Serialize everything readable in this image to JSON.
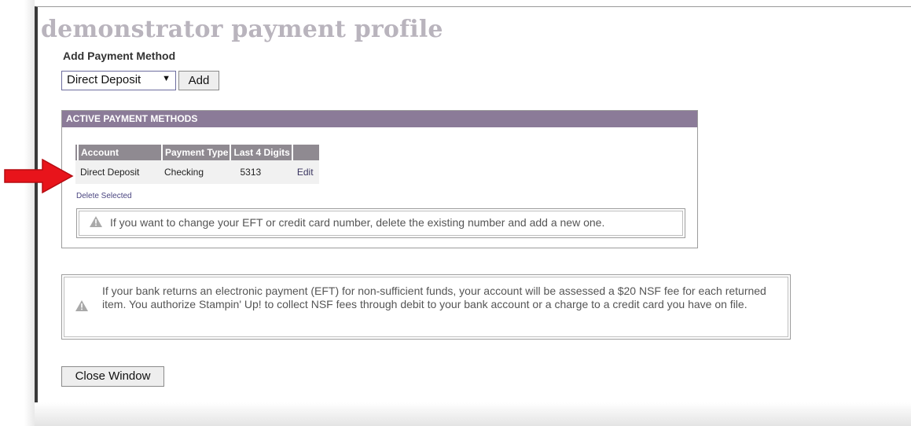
{
  "page": {
    "title": "demonstrator payment profile"
  },
  "add_method": {
    "label": "Add Payment Method",
    "selected_option": "Direct Deposit",
    "add_button": "Add"
  },
  "active_methods": {
    "header": "ACTIVE PAYMENT METHODS",
    "columns": [
      "Account",
      "Payment Type",
      "Last 4 Digits"
    ],
    "rows": [
      {
        "account": "Direct Deposit",
        "payment_type": "Checking",
        "last4": "5313",
        "action": "Edit"
      }
    ],
    "delete_link": "Delete Selected",
    "notice": "If you want to change your EFT or credit card number, delete the existing number and add a new one."
  },
  "nsf_notice": "If your bank returns an electronic payment (EFT) for non-sufficient funds, your account will be assessed a $20 NSF fee for each returned item.  You authorize Stampin' Up! to collect NSF fees through debit to your bank account or a charge to a credit card you have on file.",
  "close_button": "Close Window",
  "colors": {
    "header_purple": "#8b7b98",
    "title_gray": "#b9b4bd",
    "annotation_arrow": "#e8141b"
  },
  "icons": {
    "warning": "warning-icon",
    "dropdown": "chevron-down-icon",
    "annotation": "red-arrow"
  }
}
